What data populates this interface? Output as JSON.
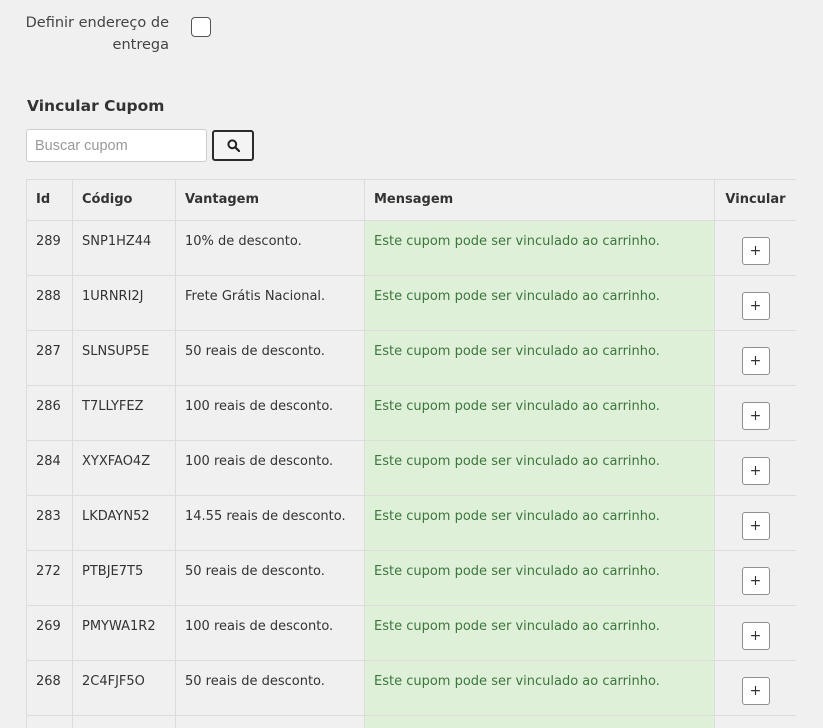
{
  "delivery": {
    "label": "Definir endereço de entrega",
    "checked": false
  },
  "coupon_section": {
    "title": "Vincular Cupom",
    "search_placeholder": "Buscar cupom",
    "search_value": "",
    "search_icon": "search-icon"
  },
  "table": {
    "headers": {
      "id": "Id",
      "code": "Código",
      "advantage": "Vantagem",
      "message": "Mensagem",
      "link": "Vincular"
    },
    "add_label": "+",
    "rows": [
      {
        "id": "289",
        "code": "SNP1HZ44",
        "advantage": "10% de desconto.",
        "message": "Este cupom pode ser vinculado ao carrinho."
      },
      {
        "id": "288",
        "code": "1URNRI2J",
        "advantage": "Frete Grátis Nacional.",
        "message": "Este cupom pode ser vinculado ao carrinho."
      },
      {
        "id": "287",
        "code": "SLNSUP5E",
        "advantage": "50 reais de desconto.",
        "message": "Este cupom pode ser vinculado ao carrinho."
      },
      {
        "id": "286",
        "code": "T7LLYFEZ",
        "advantage": "100 reais de desconto.",
        "message": "Este cupom pode ser vinculado ao carrinho."
      },
      {
        "id": "284",
        "code": "XYXFAO4Z",
        "advantage": "100 reais de desconto.",
        "message": "Este cupom pode ser vinculado ao carrinho."
      },
      {
        "id": "283",
        "code": "LKDAYN52",
        "advantage": "14.55 reais de desconto.",
        "message": "Este cupom pode ser vinculado ao carrinho."
      },
      {
        "id": "272",
        "code": "PTBJE7T5",
        "advantage": "50 reais de desconto.",
        "message": "Este cupom pode ser vinculado ao carrinho."
      },
      {
        "id": "269",
        "code": "PMYWA1R2",
        "advantage": "100 reais de desconto.",
        "message": "Este cupom pode ser vinculado ao carrinho."
      },
      {
        "id": "268",
        "code": "2C4FJF5O",
        "advantage": "50 reais de desconto.",
        "message": "Este cupom pode ser vinculado ao carrinho."
      }
    ]
  },
  "colors": {
    "success_background": "#dff0d8",
    "success_text": "#3c763d"
  }
}
